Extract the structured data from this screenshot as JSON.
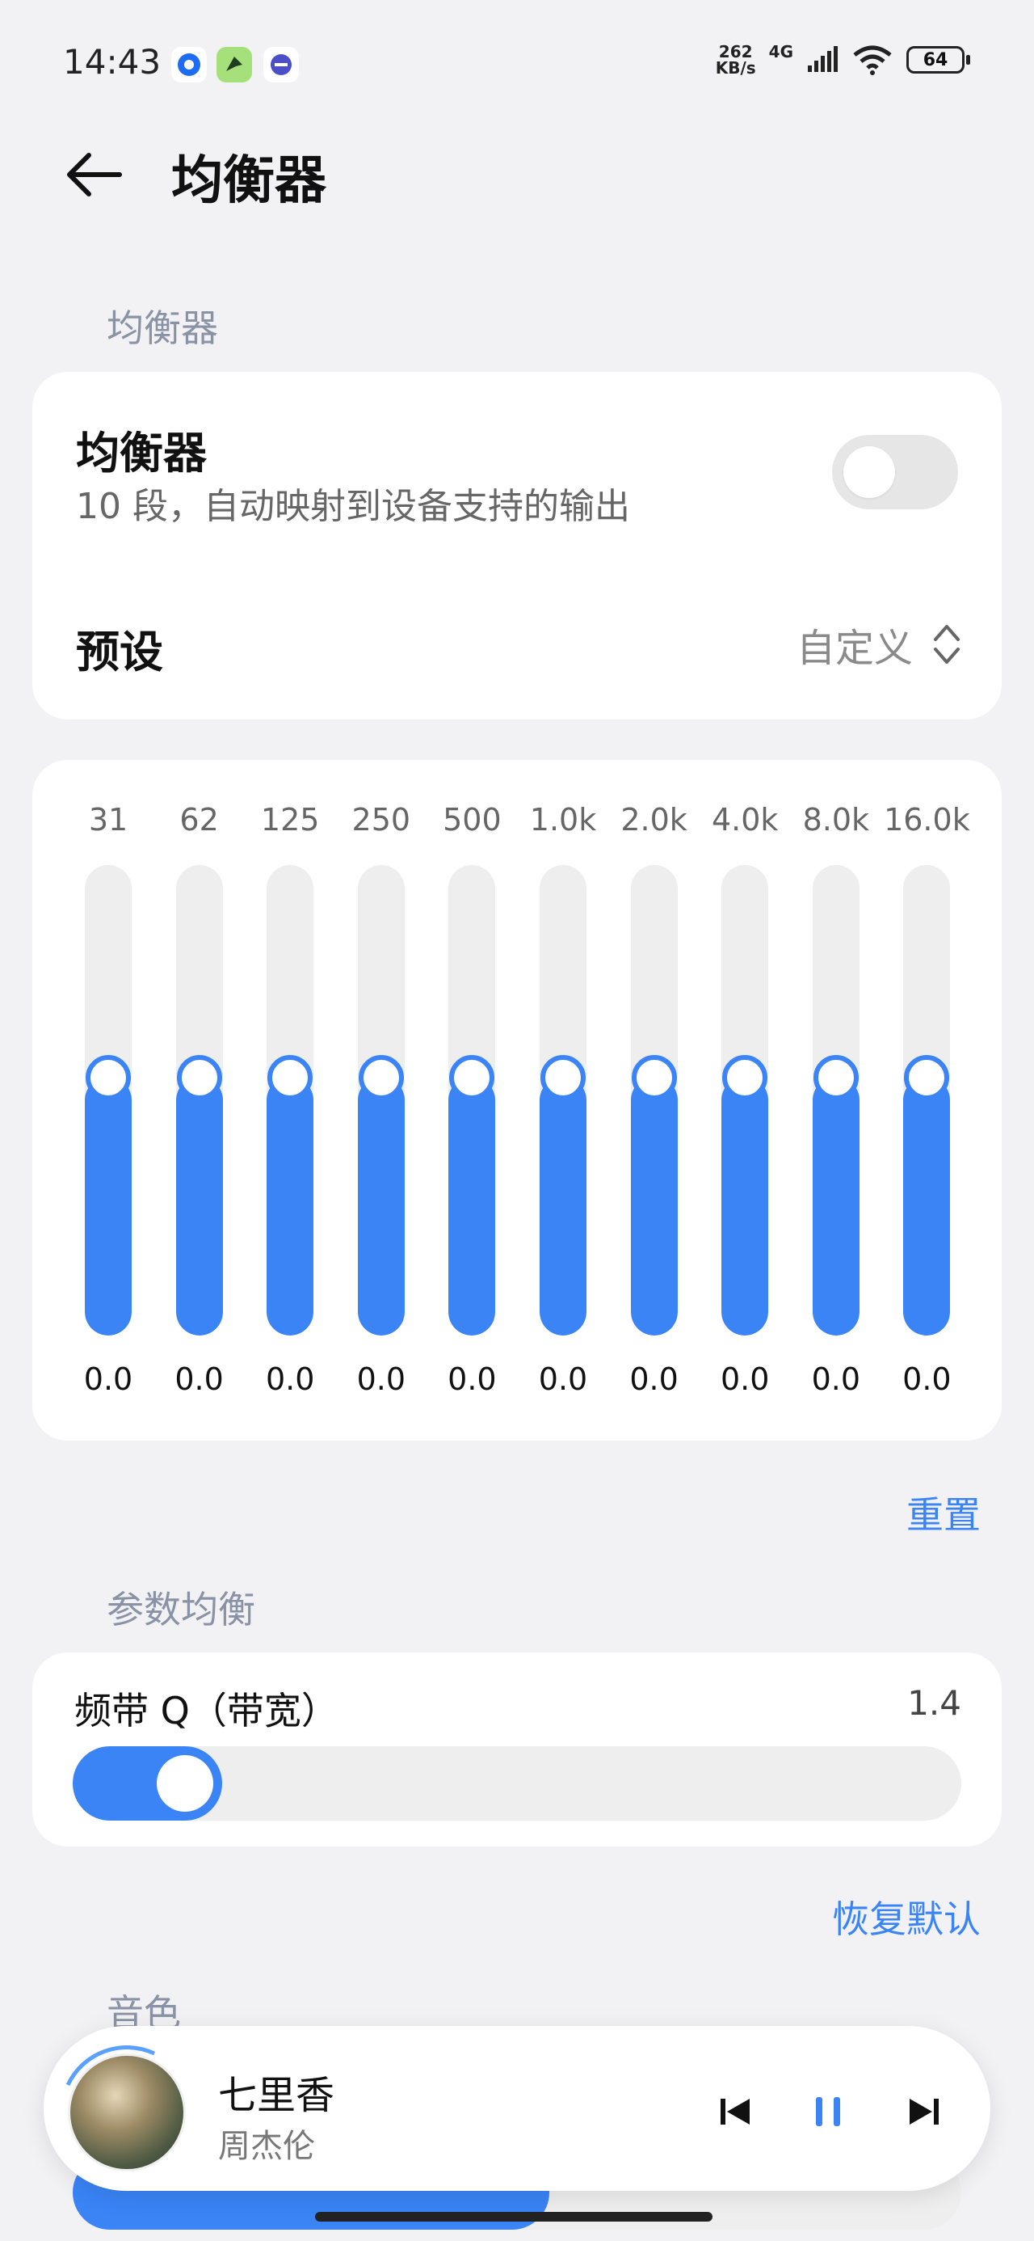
{
  "status_bar": {
    "time": "14:43",
    "network_speed_value": "262",
    "network_speed_unit": "KB/s",
    "network_type": "4G",
    "battery": "64"
  },
  "header": {
    "title": "均衡器"
  },
  "section_equalizer": {
    "label": "均衡器",
    "toggle_title": "均衡器",
    "toggle_subtitle": "10 段，自动映射到设备支持的输出",
    "toggle_on": false,
    "preset_label": "预设",
    "preset_value": "自定义"
  },
  "eq_bands": [
    {
      "freq": "31",
      "gain": "0.0",
      "level": 0.5
    },
    {
      "freq": "62",
      "gain": "0.0",
      "level": 0.5
    },
    {
      "freq": "125",
      "gain": "0.0",
      "level": 0.5
    },
    {
      "freq": "250",
      "gain": "0.0",
      "level": 0.5
    },
    {
      "freq": "500",
      "gain": "0.0",
      "level": 0.5
    },
    {
      "freq": "1.0k",
      "gain": "0.0",
      "level": 0.5
    },
    {
      "freq": "2.0k",
      "gain": "0.0",
      "level": 0.5
    },
    {
      "freq": "4.0k",
      "gain": "0.0",
      "level": 0.5
    },
    {
      "freq": "8.0k",
      "gain": "0.0",
      "level": 0.5
    },
    {
      "freq": "16.0k",
      "gain": "0.0",
      "level": 0.5
    }
  ],
  "reset_label": "重置",
  "section_parametric": {
    "label": "参数均衡",
    "q_label": "频带 Q（带宽）",
    "q_value": "1.4",
    "q_level": 0.15
  },
  "restore_default_label": "恢复默认",
  "section_timbre": {
    "label": "音色"
  },
  "player": {
    "title": "七里香",
    "artist": "周杰伦",
    "accent_color": "#3a84f6"
  }
}
